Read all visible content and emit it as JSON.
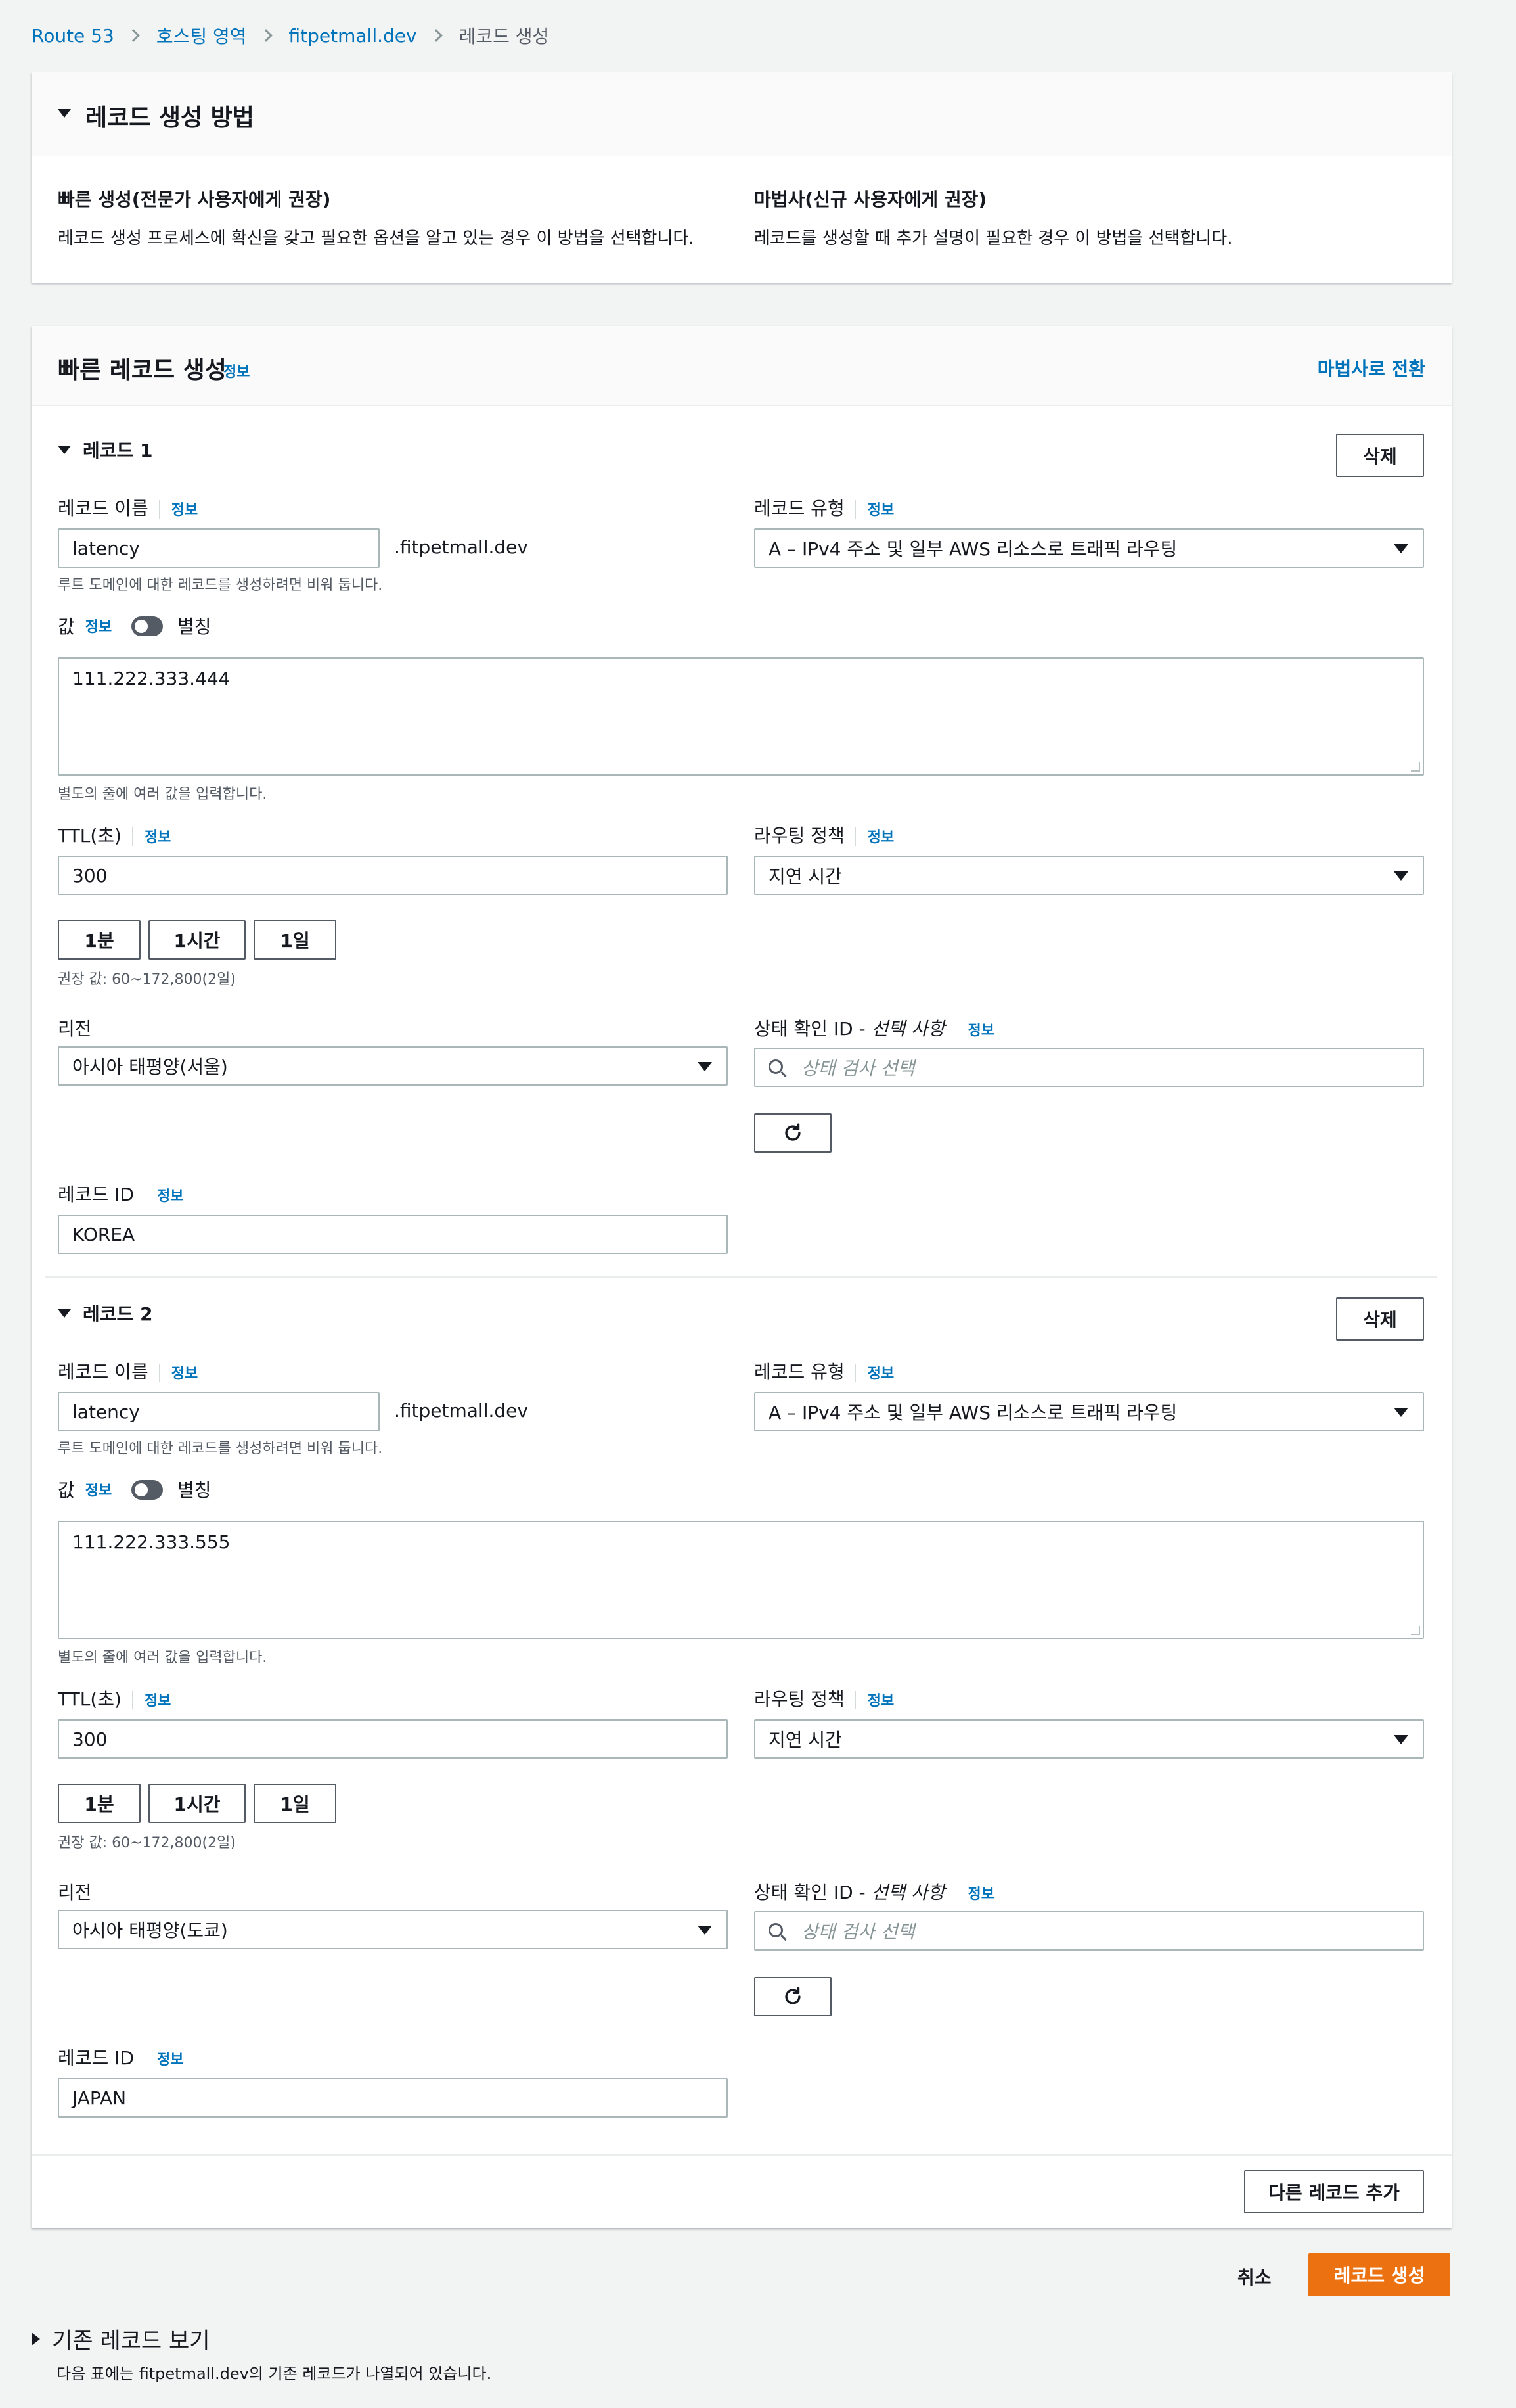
{
  "breadcrumb": [
    "Route 53",
    "호스팅 영역",
    "fitpetmall.dev",
    "레코드 생성"
  ],
  "method_panel": {
    "title": "레코드 생성 방법",
    "quick": {
      "title": "빠른 생성(전문가 사용자에게 권장)",
      "desc": "레코드 생성 프로세스에 확신을 갖고 필요한 옵션을 알고 있는 경우 이 방법을 선택합니다."
    },
    "wizard": {
      "title": "마법사(신규 사용자에게 권장)",
      "desc": "레코드를 생성할 때 추가 설명이 필요한 경우 이 방법을 선택합니다."
    }
  },
  "quick_panel": {
    "title": "빠른 레코드 생성",
    "info": "정보",
    "switch_link": "마법사로 전환",
    "add_button": "다른 레코드 추가"
  },
  "common": {
    "info": "정보",
    "delete": "삭제",
    "record_name_label": "레코드 이름",
    "domain_suffix": ".fitpetmall.dev",
    "root_hint": "루트 도메인에 대한 레코드를 생성하려면 비워 둡니다.",
    "record_type_label": "레코드 유형",
    "value_label": "값",
    "alias_label": "별칭",
    "value_hint": "별도의 줄에 여러 값을 입력합니다.",
    "ttl_label": "TTL(초)",
    "ttl_1m": "1분",
    "ttl_1h": "1시간",
    "ttl_1d": "1일",
    "ttl_hint": "권장 값: 60~172,800(2일)",
    "routing_label": "라우팅 정책",
    "region_label": "리전",
    "health_label": "상태 확인 ID - ",
    "health_optional": "선택 사항",
    "health_placeholder": "상태 검사 선택",
    "record_id_label": "레코드 ID"
  },
  "records": [
    {
      "title": "레코드 1",
      "name": "latency",
      "type": "A – IPv4 주소 및 일부 AWS 리소스로 트래픽 라우팅",
      "value": "111.222.333.444",
      "ttl": "300",
      "routing": "지연 시간",
      "region": "아시아 태평양(서울)",
      "record_id": "KOREA"
    },
    {
      "title": "레코드 2",
      "name": "latency",
      "type": "A – IPv4 주소 및 일부 AWS 리소스로 트래픽 라우팅",
      "value": "111.222.333.555",
      "ttl": "300",
      "routing": "지연 시간",
      "region": "아시아 태평양(도쿄)",
      "record_id": "JAPAN"
    }
  ],
  "footer": {
    "cancel": "취소",
    "create": "레코드 생성",
    "existing_title": "기존 레코드 보기",
    "existing_desc": "다음 표에는 fitpetmall.dev의 기존 레코드가 나열되어 있습니다."
  },
  "colors": {
    "primary": "#ec7211",
    "link": "#0073bb",
    "background": "#f2f3f3"
  }
}
